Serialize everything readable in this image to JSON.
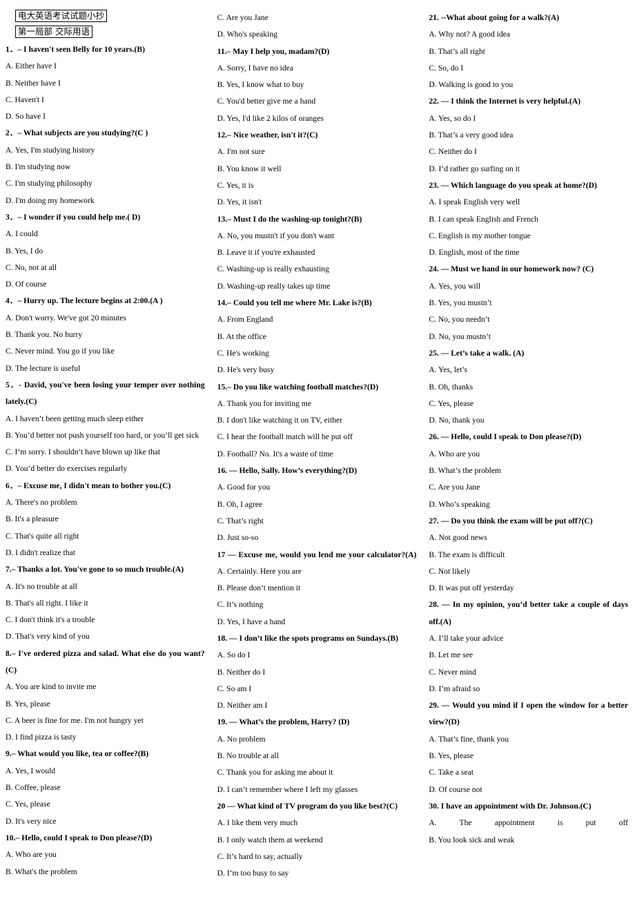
{
  "document": {
    "title_box": "电大英语考试试题小抄",
    "section_box": "第一局部  交际用语"
  },
  "questions": [
    {
      "stem": "1．– I haven't seen Belly for 10 years.(B)",
      "options": [
        "A. Either have I",
        "B. Neither have I",
        "C. Haven't I",
        "D. So have I"
      ]
    },
    {
      "stem": "2．– What subjects are you studying?(C )",
      "options": [
        "A. Yes, I'm studying history",
        "B. I'm studying now",
        "C. I'm studying philosophy",
        "D. I'm doing my homework"
      ]
    },
    {
      "stem": "3．– I wonder if you could help me.( D)",
      "options": [
        "A. I could",
        "B. Yes, I do",
        "C. No, not at all",
        "D. Of course"
      ]
    },
    {
      "stem": "4．– Hurry up. The lecture begins at 2:00.(A )",
      "options": [
        "A. Don't worry. We've got 20 minutes",
        "B. Thank you. No hurry",
        "C. Never mind. You go if you like",
        "D. The lecture is useful"
      ]
    },
    {
      "stem": "5．- David, you've been losing your temper over nothing lately.(C)",
      "stem_justify": true,
      "options": [
        "A. I haven’t been getting much sleep either",
        "B. You’d better not push yourself too hard, or you’ll get sick",
        "C. I’m sorry. I shouldn’t have blown up like that",
        "D. You’d better do exercises regularly"
      ]
    },
    {
      "stem": "6．– Excuse me, I didn't mean to bother you.(C)",
      "options": [
        "A. There's no problem",
        "B. It's a pleasure",
        "C. That's quite all right",
        "D. I didn't realize that"
      ]
    },
    {
      "stem": "7.– Thanks a lot. You've gone to so much trouble.(A)",
      "options": [
        "A. It's no trouble at all",
        "B. That's all right. I like it",
        "C. I don't think it's a trouble",
        "D. That's very kind of you"
      ]
    },
    {
      "stem": "8.– I've ordered pizza and salad. What else do you want?(C)",
      "stem_justify": true,
      "options": [
        "A. You are kind to invite me",
        "B. Yes, please",
        "C. A beer is fine for me. I'm not hungry yet",
        "D. I find pizza is tasty"
      ]
    },
    {
      "stem": "9.– What would you like, tea or coffee?(B)",
      "options": [
        "A. Yes, I would",
        "B. Coffee, please",
        "C. Yes, please",
        "D. It's very nice"
      ]
    },
    {
      "stem": "10.– Hello, could I speak to Don please?(D)",
      "options": [
        "A. Who are you",
        "B. What's the problem",
        "C. Are you Jane",
        "D. Who's speaking"
      ]
    },
    {
      "stem": "11.– May I help you, madam?(D)",
      "options": [
        "A. Sorry, I have no idea",
        "B. Yes, I know what to buy",
        "C. You'd better give me a hand",
        "D. Yes, I'd like 2 kilos of oranges"
      ]
    },
    {
      "stem": "12.– Nice weather, isn't it?(C)",
      "options": [
        "A. I'm not sure",
        "B. You know it well",
        "C. Yes, it is",
        "D. Yes, it isn't"
      ]
    },
    {
      "stem": "13.– Must I do the washing-up tonight?(B)",
      "options": [
        "A. No, you mustn't if you don't want",
        "B. Leave it if you're exhausted",
        "C. Washing-up is really exhausting",
        "D. Washing-up really takes up time"
      ]
    },
    {
      "stem": "14.– Could you tell me where Mr. Lake is?(B)",
      "options": [
        "A. From England",
        "B. At the office",
        "C. He's working",
        "D. He's very busy"
      ]
    },
    {
      "stem": "15.– Do you like watching football matches?(D)",
      "options": [
        "A. Thank you for inviting me",
        "B. I don't like watching it on TV, either",
        "C. I hear the football match will be put off",
        "D. Football? No. It's a waste of time"
      ]
    },
    {
      "stem": "16. — Hello, Sally. How’s everything?(D)",
      "options": [
        "A. Good for you",
        "B. Oh, I agree",
        "C. That’s right",
        "D. Just so-so"
      ]
    },
    {
      "stem": "17 — Excuse me, would you lend me your calculator?(A)",
      "stem_justify": true,
      "options": [
        "A. Certainly. Here you are",
        "B. Please don’t mention it",
        "C. It’s nothing",
        "D. Yes, I have a hand"
      ]
    },
    {
      "stem": "18. — I don’t like the spots programs on Sundays.(B)",
      "options": [
        "A. So do I",
        "B. Neither do I",
        "C. So am I",
        "D. Neither am I"
      ]
    },
    {
      "stem": "19. — What’s the problem, Harry? (D)",
      "options": [
        "A. No problem",
        "B. No trouble at all",
        "C. Thank you for asking me about it",
        "D. I can’t remember where I left my glasses"
      ]
    },
    {
      "stem": "20 — What kind of TV program do you like best?(C)",
      "options": [
        "A. I like them very much",
        "B. I only watch them at weekend",
        "C. It’s hard to say, actually",
        "D. I‘m too busy to say"
      ]
    },
    {
      "stem": "21. --What about going for a walk?(A)",
      "options": [
        "A. Why not? A good idea",
        "B. That’s all right",
        "C. So, do I",
        "D. Walking is good to you"
      ]
    },
    {
      "stem": "22. — I think the Internet is very helpful.(A)",
      "options": [
        "A. Yes, so do I",
        "B. That’s a very good idea",
        "C. Neither do I",
        "D. I’d rather go surfing on it"
      ]
    },
    {
      "stem": "23. — Which language do you speak at home?(D)",
      "options": [
        "A. I speak English very well",
        "B. I can speak English and French",
        "C. English is my mother tongue",
        "D. English, most of the time"
      ]
    },
    {
      "stem": "24. — Must we hand in our homework now? (C)",
      "options": [
        "A. Yes, you will",
        "B. Yes, you mustn’t",
        "C. No, you needn’t",
        "D. No, you mustn’t"
      ]
    },
    {
      "stem": "25. — Let’s take a walk. (A)",
      "options": [
        "A. Yes, let’s",
        "B. Oh, thanks",
        "C. Yes, please",
        "D. No, thank you"
      ]
    },
    {
      "stem": "26. — Hello, could I speak to Don please?(D)",
      "options": [
        "A. Who are you",
        "B. What’s the problem",
        "C. Are you Jane",
        "D. Who’s speaking"
      ]
    },
    {
      "stem": "27. — Do you think the exam will be put off?(C)",
      "options": [
        "A. Not good news",
        "B. The exam is difficult",
        "C. Not likely",
        "D. It was put off yesterday"
      ]
    },
    {
      "stem": "28. — In my opinion, you’d better take a couple of days off.(A)",
      "stem_justify": true,
      "options": [
        "A. I’ll take your advice",
        "B. Let me see",
        "C. Never mind",
        "D. I’m afraid so"
      ]
    },
    {
      "stem": "29. — Would you mind if I open the window for a better view?(D)",
      "stem_justify": true,
      "options": [
        "A. That’s fine, thank you",
        "B. Yes, please",
        "C. Take a seat",
        "D. Of course not"
      ]
    },
    {
      "stem": "30.  I have an appointment with Dr. Johnson.(C)",
      "options": [
        "A.      The      appointment      is      put      off",
        "B. You look sick and weak"
      ],
      "option_stretch": [
        true,
        false
      ]
    }
  ]
}
